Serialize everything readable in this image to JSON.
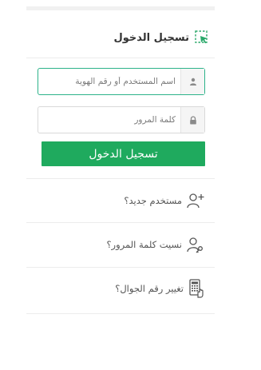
{
  "login": {
    "title": "تسجيل الدخول",
    "username_placeholder": "اسم المستخدم أو رقم الهوية",
    "password_placeholder": "كلمة المرور",
    "submit_label": "تسجيل الدخول"
  },
  "links": {
    "new_user": "مستخدم جديد؟",
    "forgot_password": "نسيت كلمة المرور؟",
    "change_mobile": "تغيير رقم الجوال؟"
  },
  "icons": {
    "title": "cursor-select-icon",
    "username": "user-icon",
    "password": "lock-icon",
    "new_user": "user-plus-icon",
    "forgot_password": "user-key-icon",
    "change_mobile": "phone-hand-icon"
  },
  "colors": {
    "accent_green": "#1faa5e",
    "active_border": "#2db38a",
    "icon_green": "#2aa86a"
  }
}
